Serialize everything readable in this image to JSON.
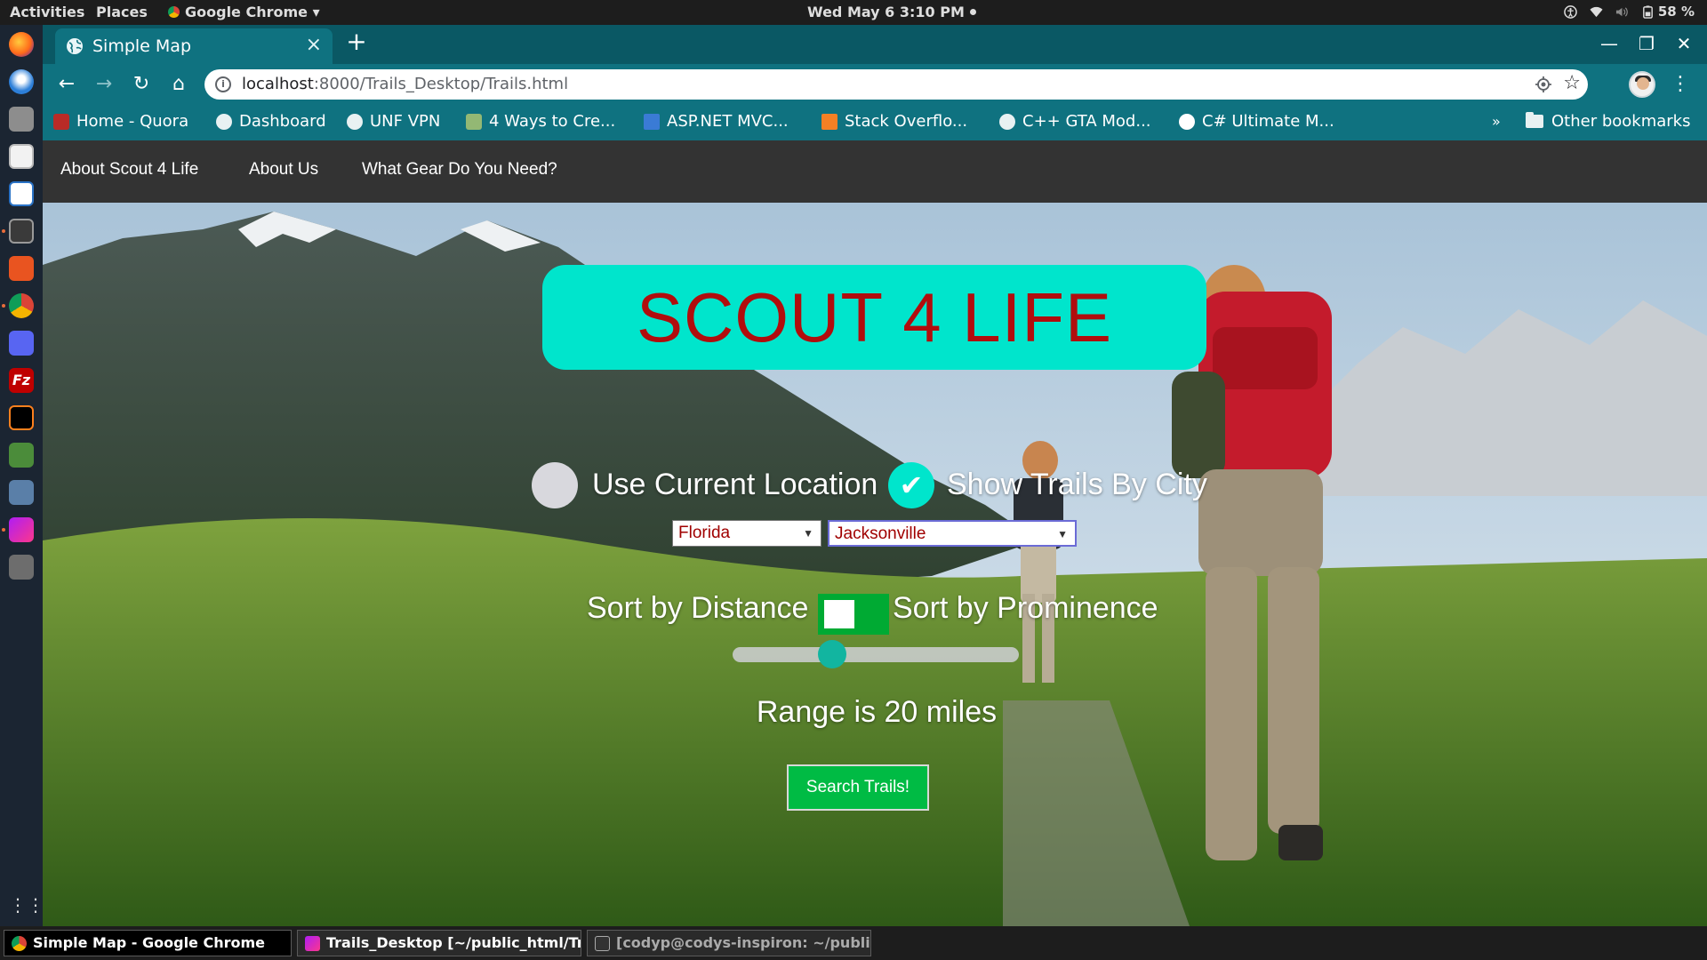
{
  "system": {
    "activities": "Activities",
    "places": "Places",
    "app_menu": "Google Chrome ▾",
    "clock": "Wed May 6   3:10 PM",
    "battery": "58 %"
  },
  "browser": {
    "tab_title": "Simple Map",
    "new_tab": "+",
    "url_host": "localhost",
    "url_path": ":8000/Trails_Desktop/Trails.html",
    "bookmarks": [
      {
        "label": "Home - Quora",
        "icon": "quora-icon",
        "color": "#b92b27"
      },
      {
        "label": "Dashboard",
        "icon": "globe-icon",
        "color": "#e8f1f2"
      },
      {
        "label": "UNF VPN",
        "icon": "globe-icon",
        "color": "#e8f1f2"
      },
      {
        "label": "4 Ways to Cre...",
        "icon": "wikihow-icon",
        "color": "#93b874"
      },
      {
        "label": "ASP.NET MVC...",
        "icon": "visual-studio-icon",
        "color": "#3a7bd5"
      },
      {
        "label": "Stack Overflo...",
        "icon": "stackoverflow-icon",
        "color": "#f48024"
      },
      {
        "label": "C++ GTA Mod...",
        "icon": "globe-icon",
        "color": "#e8f1f2"
      },
      {
        "label": "C# Ultimate M...",
        "icon": "github-icon",
        "color": "#ffffff"
      }
    ],
    "more_bookmarks": "»",
    "other_bookmarks": "Other bookmarks"
  },
  "site": {
    "nav": [
      "About Scout 4 Life",
      "About Us",
      "What Gear Do You Need?"
    ],
    "title": "SCOUT 4 LIFE",
    "option_location": "Use Current Location",
    "option_city": "Show Trails By City",
    "city_selected": true,
    "state_value": "Florida",
    "city_value": "Jacksonville",
    "sort_distance": "Sort by Distance",
    "sort_prominence": "Sort by Prominence",
    "range_miles": 20,
    "range_text": "Range is 20 miles",
    "search_button": "Search Trails!",
    "colors": {
      "title_bg": "#00e5cc",
      "title_text": "#b10d0d",
      "button": "#00bb44",
      "toggle": "#00aa33",
      "nav_bg": "#333333"
    }
  },
  "taskbar": {
    "chrome": "Simple Map - Google Chrome",
    "phpstorm": "Trails_Desktop [~/public_html/Trai...",
    "terminal": "[codyp@codys-inspiron: ~/public_..."
  }
}
